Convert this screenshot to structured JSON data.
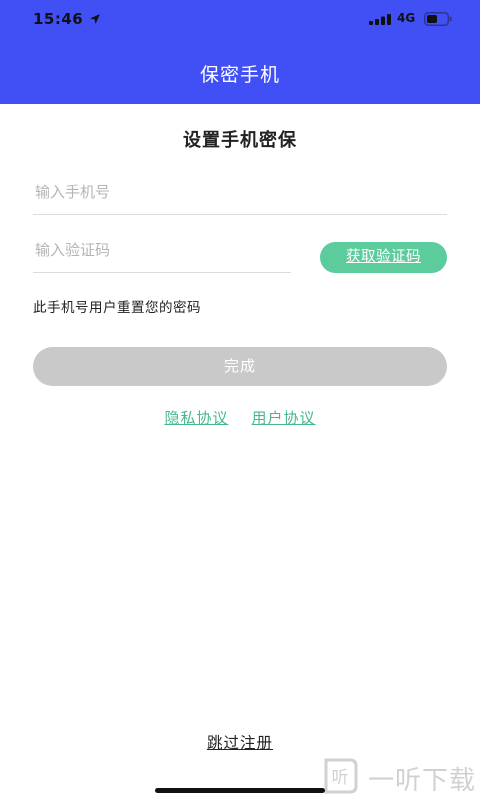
{
  "status_bar": {
    "time": "15:46",
    "network": "4G",
    "icons": [
      "location-arrow-icon",
      "signal-bars-icon",
      "battery-icon"
    ]
  },
  "header": {
    "title": "保密手机",
    "background_color": "#4150f5"
  },
  "form": {
    "title": "设置手机密保",
    "phone_placeholder": "输入手机号",
    "code_placeholder": "输入验证码",
    "get_code_label": "获取验证码",
    "hint": "此手机号用户重置您的密码",
    "done_label": "完成"
  },
  "links": {
    "privacy_label": "隐私协议",
    "user_agreement_label": "用户协议"
  },
  "footer": {
    "skip_label": "跳过注册"
  },
  "watermark": {
    "text": "一听下载",
    "logo_text": "听"
  },
  "colors": {
    "accent_green": "#5ccc9c",
    "link_green": "#46b98a",
    "disabled_button": "#c9c9c9"
  }
}
